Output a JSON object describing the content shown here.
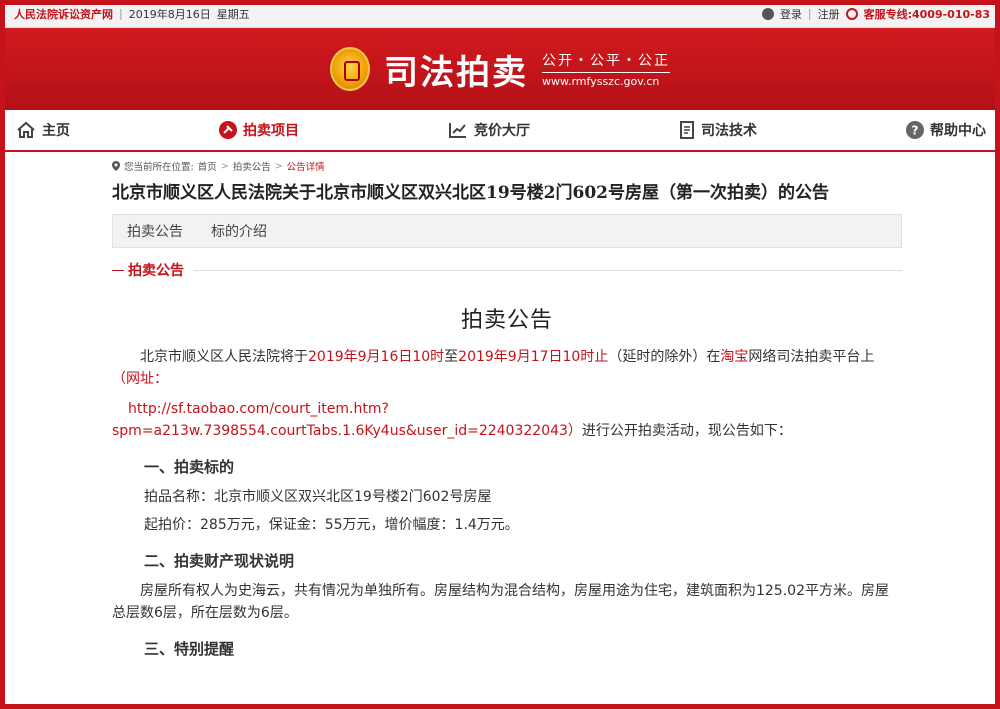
{
  "topbar": {
    "site_name": "人民法院诉讼资产网",
    "date": "2019年8月16日",
    "weekday": "星期五",
    "login": "登录",
    "register": "注册",
    "hotline_label": "客服专线:",
    "hotline_number": "4009-010-83"
  },
  "banner": {
    "brand": "司法拍卖",
    "slogan": "公开・公平・公正",
    "url": "www.rmfysszc.gov.cn"
  },
  "nav": {
    "items": [
      {
        "label": "主页",
        "icon": "home-icon"
      },
      {
        "label": "拍卖项目",
        "icon": "gavel-icon"
      },
      {
        "label": "竞价大厅",
        "icon": "chart-icon"
      },
      {
        "label": "司法技术",
        "icon": "document-icon"
      },
      {
        "label": "帮助中心",
        "icon": "help-icon"
      }
    ],
    "active_index": 1
  },
  "breadcrumb": {
    "prefix": "您当前所在位置:",
    "home": "首页",
    "notice": "拍卖公告",
    "current": "公告详情"
  },
  "page_title": "北京市顺义区人民法院关于北京市顺义区双兴北区19号楼2门602号房屋（第一次拍卖）的公告",
  "tabs": [
    "拍卖公告",
    "标的介绍"
  ],
  "section_label": "拍卖公告",
  "doc": {
    "title": "拍卖公告",
    "intro_a": "北京市顺义区人民法院将于",
    "intro_start": "2019年9月16日10时",
    "intro_b": "至",
    "intro_end": "2019年9月17日10时止",
    "intro_c": "（延时的除外）在",
    "intro_platform": "淘宝",
    "intro_d": "网络司法拍卖平台上",
    "intro_url_label": "（网址：",
    "url_line1": "http://sf.taobao.com/court_item.htm?",
    "url_line2": "spm=a213w.7398554.courtTabs.1.6Ky4us&user_id=2240322043）",
    "intro_e": "进行公开拍卖活动，现公告如下：",
    "h1": "一、拍卖标的",
    "item_name": "拍品名称：北京市顺义区双兴北区19号楼2门602号房屋",
    "item_price": "起拍价：285万元，保证金：55万元，增价幅度：1.4万元。",
    "h2": "二、拍卖财产现状说明",
    "status_text": "房屋所有权人为史海云，共有情况为单独所有。房屋结构为混合结构，房屋用途为住宅，建筑面积为125.02平方米。房屋总层数6层，所在层数为6层。",
    "h3": "三、特别提醒"
  },
  "colors": {
    "accent": "#c4131b",
    "banner": "#c9161c",
    "tabs_bg": "#f2f2f2"
  }
}
